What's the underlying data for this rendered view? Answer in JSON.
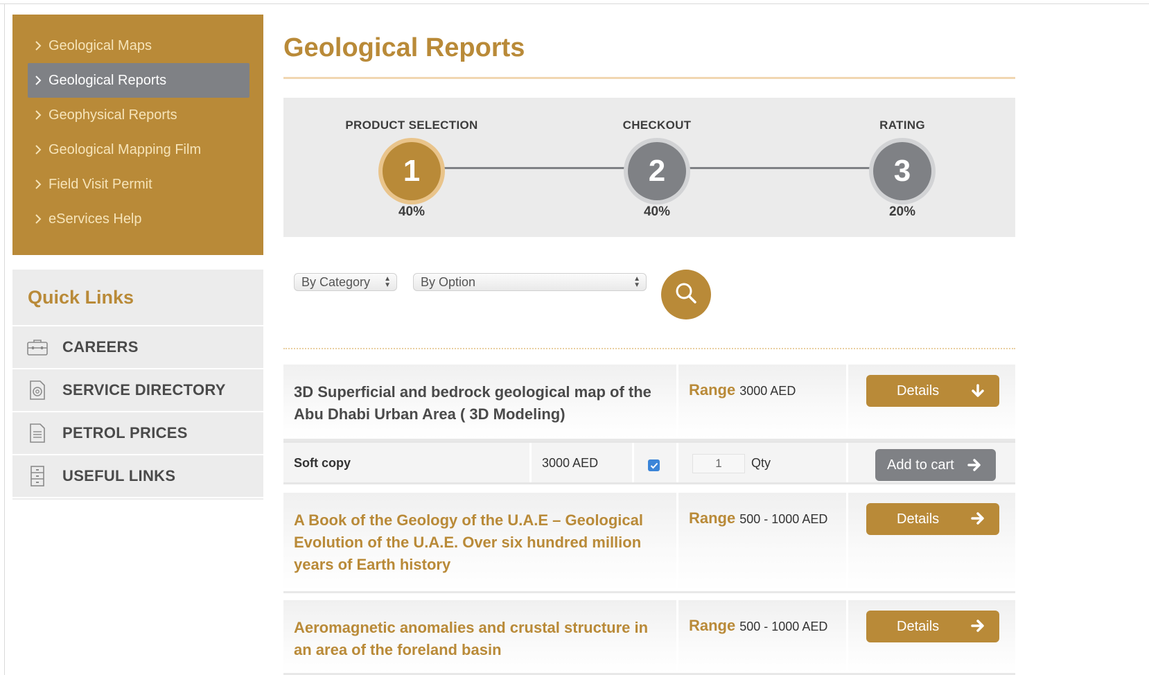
{
  "sidebar": {
    "items": [
      {
        "label": "Geological Maps"
      },
      {
        "label": "Geological Reports"
      },
      {
        "label": "Geophysical Reports"
      },
      {
        "label": "Geological Mapping Film"
      },
      {
        "label": "Field Visit Permit"
      },
      {
        "label": "eServices Help"
      }
    ],
    "active_index": 1
  },
  "quick_links": {
    "title": "Quick Links",
    "items": [
      {
        "label": "CAREERS",
        "icon": "briefcase-icon"
      },
      {
        "label": "SERVICE DIRECTORY",
        "icon": "service-directory-icon"
      },
      {
        "label": "PETROL PRICES",
        "icon": "document-icon"
      },
      {
        "label": "USEFUL LINKS",
        "icon": "cabinet-icon"
      }
    ]
  },
  "main": {
    "title": "Geological Reports",
    "steps": [
      {
        "label": "PRODUCT SELECTION",
        "number": "1",
        "percent": "40%",
        "state": "active"
      },
      {
        "label": "CHECKOUT",
        "number": "2",
        "percent": "40%",
        "state": "inactive"
      },
      {
        "label": "RATING",
        "number": "3",
        "percent": "20%",
        "state": "inactive"
      }
    ],
    "filters": {
      "category": {
        "selected": "By Category"
      },
      "option": {
        "selected": "By Option"
      }
    },
    "products": [
      {
        "title": "3D Superficial and bedrock geological map of the Abu Dhabi Urban Area ( 3D Modeling)",
        "range_label": "Range",
        "range_value": "3000 AED",
        "details_label": "Details",
        "expanded": true,
        "variant": {
          "type": "Soft copy",
          "price": "3000 AED",
          "selected": true,
          "qty": "1",
          "qty_label": "Qty",
          "add_label": "Add to cart"
        }
      },
      {
        "title": "A Book of the Geology of the U.A.E – Geological Evolution of the U.A.E. Over six hundred million years of Earth history",
        "range_label": "Range",
        "range_value": "500 - 1000 AED",
        "details_label": "Details",
        "expanded": false
      },
      {
        "title": "Aeromagnetic anomalies and crustal structure in an area of the foreland basin",
        "range_label": "Range",
        "range_value": "500 - 1000 AED",
        "details_label": "Details",
        "expanded": false
      }
    ]
  },
  "colors": {
    "gold": "#b98a38",
    "gold_light": "#e9c48b",
    "grey": "#7f8185",
    "nav_text": "#f6e4b9",
    "panel_bg": "#ebebeb",
    "checkbox_blue": "#3b85d8"
  }
}
